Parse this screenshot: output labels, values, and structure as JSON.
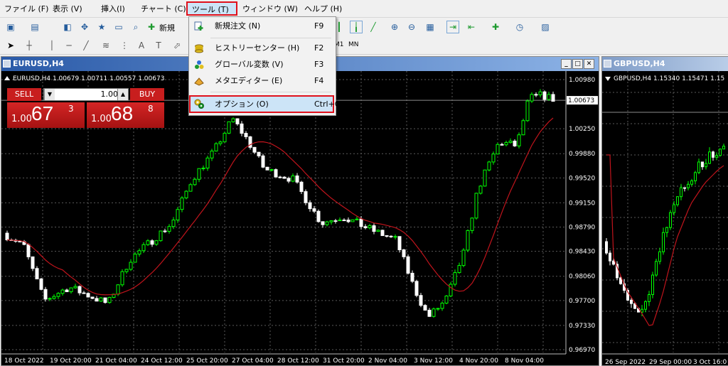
{
  "menubar": {
    "items": [
      "ファイル (F)",
      "表示 (V)",
      "挿入(I)",
      "チャート (C)",
      "ツール (T)",
      "ウィンドウ (W)",
      "ヘルプ (H)"
    ]
  },
  "toolbar": {
    "new_order_label": "新規",
    "m1": "M1",
    "mn": "MN"
  },
  "tools_menu": {
    "items": [
      {
        "label": "新規注文 (N)",
        "shortcut": "F9",
        "icon": "new-order-icon"
      },
      {
        "label": "ヒストリーセンター (H)",
        "shortcut": "F2",
        "icon": "history-center-icon"
      },
      {
        "label": "グローバル変数 (V)",
        "shortcut": "F3",
        "icon": "global-variables-icon"
      },
      {
        "label": "メタエディター (E)",
        "shortcut": "F4",
        "icon": "metaeditor-icon"
      },
      {
        "label": "オプション (O)",
        "shortcut": "Ctrl+O",
        "icon": "options-icon"
      }
    ]
  },
  "eurusd": {
    "title": "EURUSD,H4",
    "info": "EURUSD,H4  1.00679 1.00711 1.00557 1.00673",
    "current_price": "1.00673",
    "sell_label": "SELL",
    "buy_label": "BUY",
    "lot": "1.00",
    "sell_small": "1.00",
    "sell_big": "67",
    "sell_sup": "3",
    "buy_small": "1.00",
    "buy_big": "68",
    "buy_sup": "8",
    "price_ticks": [
      "1.00980",
      "1.00250",
      "0.99880",
      "0.99520",
      "0.99150",
      "0.98790",
      "0.98430",
      "0.98060",
      "0.97700",
      "0.97330",
      "0.96970"
    ],
    "time_ticks": [
      "18 Oct 2022",
      "19 Oct 20:00",
      "21 Oct 04:00",
      "24 Oct 12:00",
      "25 Oct 20:00",
      "27 Oct 04:00",
      "28 Oct 12:00",
      "31 Oct 20:00",
      "2 Nov 04:00",
      "3 Nov 12:00",
      "4 Nov 20:00",
      "8 Nov 04:00"
    ]
  },
  "gbpusd": {
    "title": "GBPUSD,H4",
    "info": "GBPUSD,H4  1.15340 1.15471 1.15",
    "time_ticks": [
      "26 Sep 2022",
      "29 Sep 00:00",
      "3 Oct 16:0"
    ]
  },
  "colors": {
    "bull": "#00ff00",
    "bear": "#ffffff",
    "ma": "#c0141c",
    "highlight": "#e0101b"
  }
}
